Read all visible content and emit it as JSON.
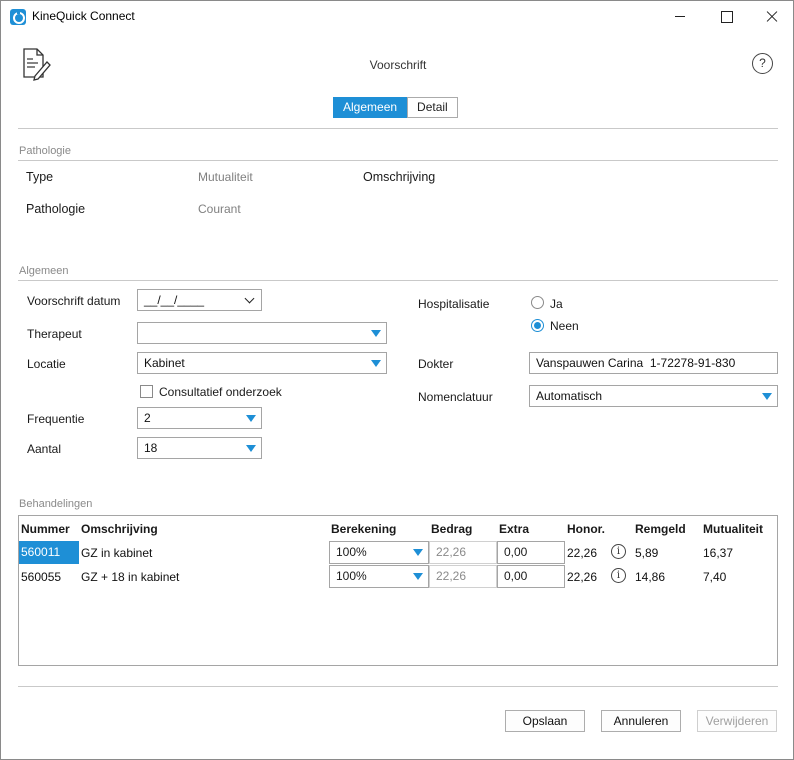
{
  "window": {
    "title": "KineQuick Connect"
  },
  "header": {
    "title": "Voorschrift",
    "help": "?"
  },
  "tabs": [
    {
      "label": "Algemeen",
      "active": true
    },
    {
      "label": "Detail",
      "active": false
    }
  ],
  "pathologie": {
    "section_label": "Pathologie",
    "type_label": "Type",
    "type_value": "Mutualiteit",
    "omschrijving_label": "Omschrijving",
    "pathologie_label": "Pathologie",
    "pathologie_value": "Courant"
  },
  "algemeen": {
    "section_label": "Algemeen",
    "voorschrift_datum_label": "Voorschrift datum",
    "voorschrift_datum_value": "__/__/____",
    "therapeut_label": "Therapeut",
    "therapeut_value": "",
    "locatie_label": "Locatie",
    "locatie_value": "Kabinet",
    "consultatief_label": "Consultatief onderzoek",
    "frequentie_label": "Frequentie",
    "frequentie_value": "2",
    "aantal_label": "Aantal",
    "aantal_value": "18",
    "hospitalisatie_label": "Hospitalisatie",
    "hosp_ja": "Ja",
    "hosp_neen": "Neen",
    "dokter_label": "Dokter",
    "dokter_value": "Vanspauwen Carina  1-72278-91-830",
    "nomenclatuur_label": "Nomenclatuur",
    "nomenclatuur_value": "Automatisch"
  },
  "behandelingen": {
    "section_label": "Behandelingen",
    "columns": [
      "Nummer",
      "Omschrijving",
      "Berekening",
      "Bedrag",
      "Extra",
      "Honor.",
      "Remgeld",
      "Mutualiteit"
    ],
    "rows": [
      {
        "nummer": "560011",
        "omschrijving": "GZ in kabinet",
        "berekening": "100%",
        "bedrag": "22,26",
        "extra": "0,00",
        "honor": "22,26",
        "remgeld": "5,89",
        "mutualiteit": "16,37"
      },
      {
        "nummer": "560055",
        "omschrijving": "GZ + 18 in kabinet",
        "berekening": "100%",
        "bedrag": "22,26",
        "extra": "0,00",
        "honor": "22,26",
        "remgeld": "14,86",
        "mutualiteit": "7,40"
      }
    ]
  },
  "footer": {
    "save": "Opslaan",
    "cancel": "Annuleren",
    "delete": "Verwijderen"
  },
  "colors": {
    "accent": "#1e8fd6"
  },
  "icons": {
    "app": "kinequick-logo-icon",
    "document": "prescription-document-icon",
    "info": "info-icon"
  }
}
